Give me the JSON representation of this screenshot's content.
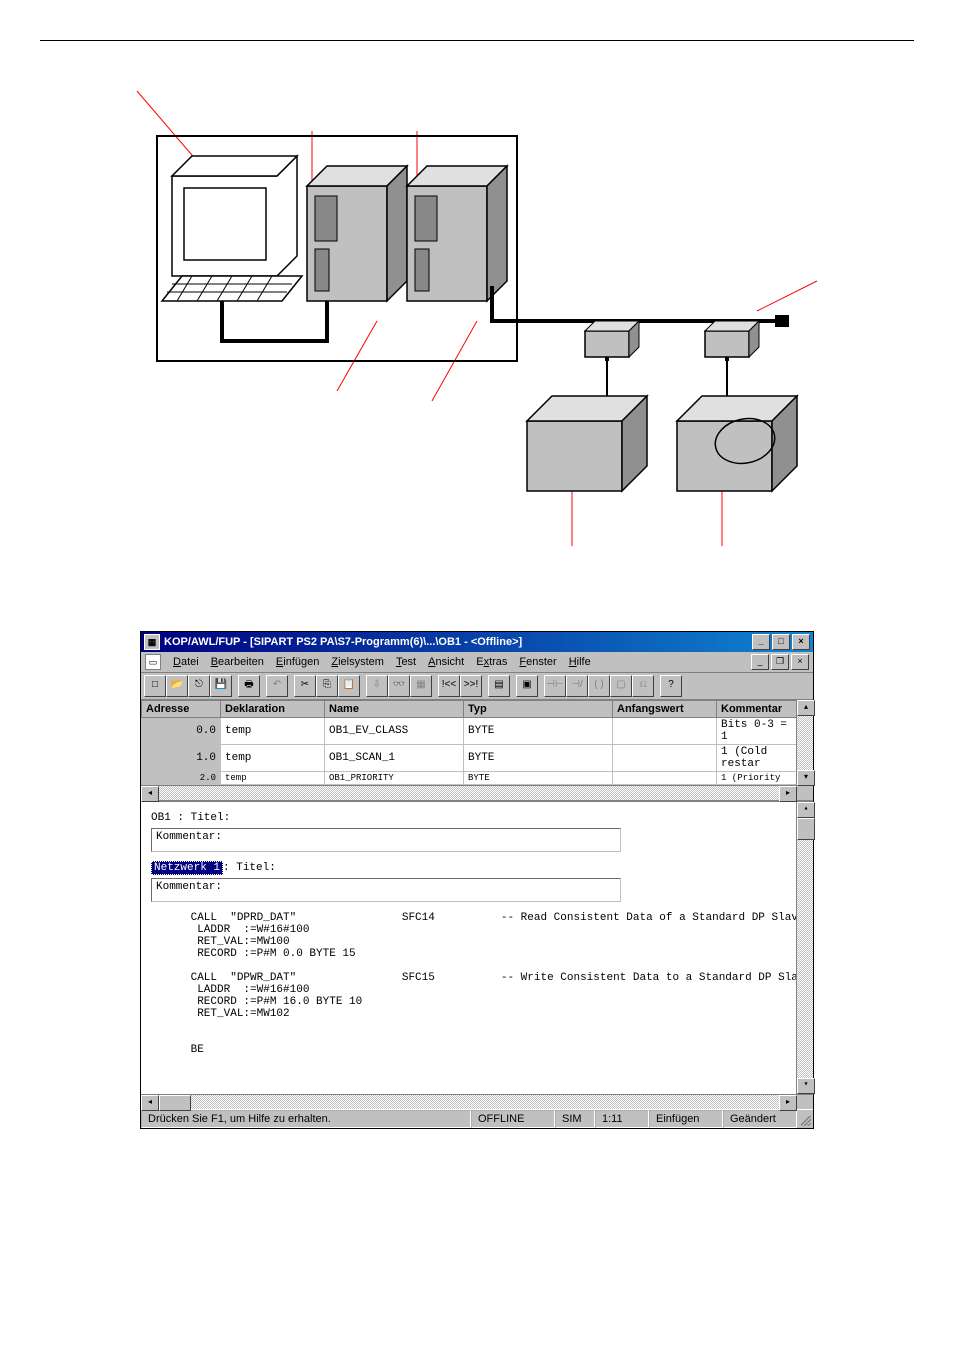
{
  "window": {
    "title": "KOP/AWL/FUP  - [SIPART PS2 PA\\S7-Programm(6)\\...\\OB1 - <Offline>]"
  },
  "menubar": {
    "items": [
      {
        "label": "Datei",
        "accel": "D"
      },
      {
        "label": "Bearbeiten",
        "accel": "B"
      },
      {
        "label": "Einfügen",
        "accel": "E"
      },
      {
        "label": "Zielsystem",
        "accel": "Z"
      },
      {
        "label": "Test",
        "accel": "T"
      },
      {
        "label": "Ansicht",
        "accel": "A"
      },
      {
        "label": "Extras",
        "accel": "x"
      },
      {
        "label": "Fenster",
        "accel": "F"
      },
      {
        "label": "Hilfe",
        "accel": "H"
      }
    ]
  },
  "decl": {
    "headers": {
      "addr": "Adresse",
      "decl": "Deklaration",
      "name": "Name",
      "type": "Typ",
      "init": "Anfangswert",
      "comment": "Kommentar"
    },
    "rows": [
      {
        "addr": "0.0",
        "decl": "temp",
        "name": "OB1_EV_CLASS",
        "type": "BYTE",
        "init": "",
        "comment": "Bits 0-3 = 1"
      },
      {
        "addr": "1.0",
        "decl": "temp",
        "name": "OB1_SCAN_1",
        "type": "BYTE",
        "init": "",
        "comment": "1 (Cold restar"
      },
      {
        "addr": "2.0",
        "decl": "temp",
        "name": "OB1_PRIORITY",
        "type": "BYTE",
        "init": "",
        "comment": "1 (Priority"
      }
    ]
  },
  "code": {
    "ob_title": "OB1 : Titel:",
    "comment_label": "Kommentar:",
    "network_label": "Netzwerk 1",
    "network_title_suffix": ": Titel:",
    "body": "      CALL  \"DPRD_DAT\"                SFC14          -- Read Consistent Data of a Standard DP Slave\n       LADDR  :=W#16#100\n       RET_VAL:=MW100\n       RECORD :=P#M 0.0 BYTE 15\n\n      CALL  \"DPWR_DAT\"                SFC15          -- Write Consistent Data to a Standard DP Slave\n       LADDR  :=W#16#100\n       RECORD :=P#M 16.0 BYTE 10\n       RET_VAL:=MW102\n\n\n      BE"
  },
  "status": {
    "hint": "Drücken Sie F1, um Hilfe zu erhalten.",
    "offline": "OFFLINE",
    "sim": "SIM",
    "pos": "1:11",
    "insert": "Einfügen",
    "changed": "Geändert"
  }
}
